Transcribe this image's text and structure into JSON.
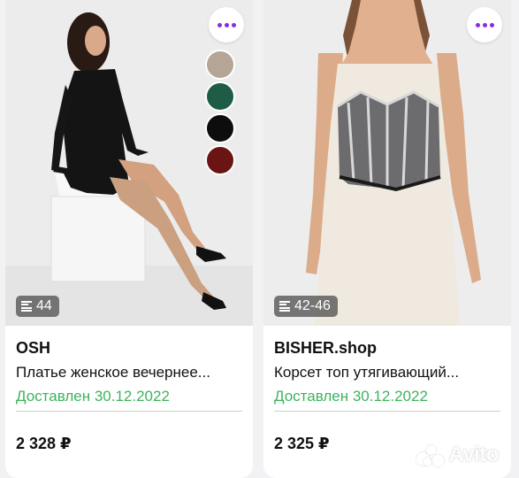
{
  "listings": [
    {
      "seller": "OSH",
      "title": "Платье женское вечернее...",
      "delivery": "Доставлен 30.12.2022",
      "size": "44",
      "price": "2 328 ₽",
      "swatch_colors": [
        "#b5a597",
        "#1f5c45",
        "#0d0d0d",
        "#6b1414"
      ]
    },
    {
      "seller": "BISHER.shop",
      "title": "Корсет топ утягивающий...",
      "delivery": "Доставлен 30.12.2022",
      "size": "42-46",
      "price": "2 325 ₽"
    }
  ],
  "watermark": {
    "text": "Avito"
  },
  "colors": {
    "accent": "#8a2be2",
    "delivery": "#3db35c"
  },
  "icons": [
    "more-dots-icon",
    "size-ruler-icon",
    "avito-logo-icon"
  ]
}
